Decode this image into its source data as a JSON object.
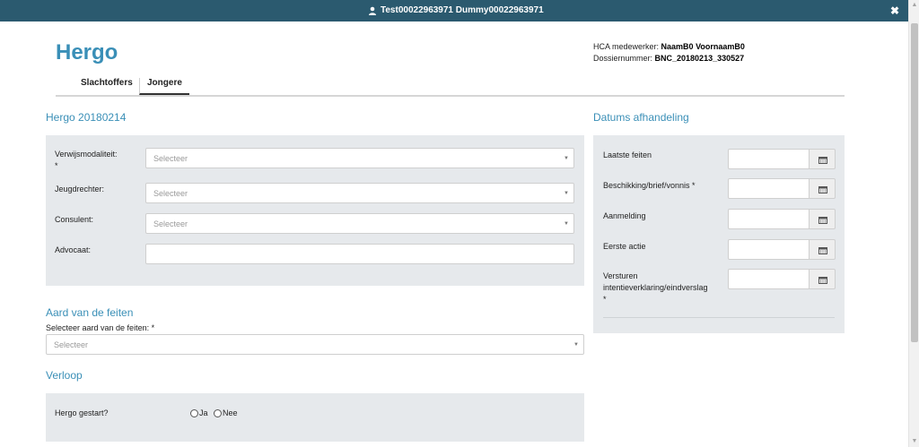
{
  "titlebar": {
    "user_name": "Test00022963971 Dummy00022963971",
    "close_label": "✖"
  },
  "header": {
    "brand": "Hergo",
    "medewerker_label": "HCA medewerker:",
    "medewerker_value": "NaamB0 VoornaamB0",
    "dossier_label": "Dossiernummer:",
    "dossier_value": "BNC_20180213_330527"
  },
  "tabs": [
    {
      "label": "Slachtoffers"
    },
    {
      "label": "Jongere"
    }
  ],
  "hergo_section": {
    "title": "Hergo 20180214",
    "fields": [
      {
        "label": "Verwijsmodaliteit:",
        "required_mark": "*",
        "placeholder": "Selecteer"
      },
      {
        "label": "Jeugdrechter:",
        "placeholder": "Selecteer"
      },
      {
        "label": "Consulent:",
        "placeholder": "Selecteer"
      },
      {
        "label": "Advocaat:",
        "value": ""
      }
    ]
  },
  "aard_section": {
    "title": "Aard van de feiten",
    "label": "Selecteer aard van de feiten: *",
    "placeholder": "Selecteer"
  },
  "verloop_section": {
    "title": "Verloop",
    "question": "Hergo gestart?",
    "options": [
      {
        "label": "Ja"
      },
      {
        "label": "Nee"
      }
    ]
  },
  "datums_section": {
    "title": "Datums afhandeling",
    "fields": [
      {
        "label": "Laatste feiten"
      },
      {
        "label": "Beschikking/brief/vonnis *"
      },
      {
        "label": "Aanmelding"
      },
      {
        "label": "Eerste actie"
      },
      {
        "label": "Versturen intentieverklaring/eindverslag",
        "required_mark": "*"
      }
    ]
  },
  "colors": {
    "accent": "#3a8fb7",
    "titlebar": "#2b5a6f",
    "panel": "#e6e9ec"
  },
  "icons": {
    "user": "user-icon",
    "close": "close-icon",
    "calendar": "calendar-icon",
    "caret": "caret-down-icon"
  }
}
